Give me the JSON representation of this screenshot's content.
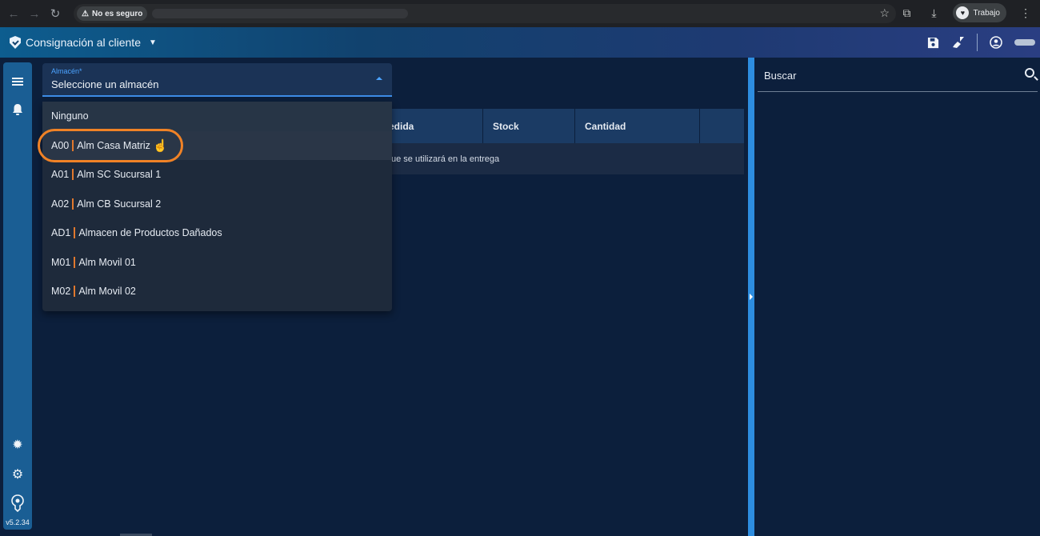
{
  "browser": {
    "security_label": "No es seguro",
    "profile_label": "Trabajo"
  },
  "app": {
    "title": "Consignación al cliente",
    "version": "v5.2.34"
  },
  "select": {
    "label": "Almacén*",
    "value": "Seleccione un almacén"
  },
  "dropdown": {
    "items": [
      {
        "code": "",
        "name": "Ninguno"
      },
      {
        "code": "A00",
        "name": "Alm Casa Matriz"
      },
      {
        "code": "A01",
        "name": "Alm SC Sucursal 1"
      },
      {
        "code": "A02",
        "name": "Alm CB Sucursal 2"
      },
      {
        "code": "AD1",
        "name": "Almacen de Productos Dañados"
      },
      {
        "code": "M01",
        "name": "Alm Movil 01"
      },
      {
        "code": "M02",
        "name": "Alm Movil 02"
      }
    ]
  },
  "table": {
    "columns": [
      "edida",
      "Stock",
      "Cantidad",
      ""
    ],
    "empty_message": "ue se utilizará en la entrega"
  },
  "right_panel": {
    "search_placeholder": "Buscar"
  },
  "colors": {
    "accent": "#3d8ce6",
    "highlight_ring": "#f08226",
    "separator": "#e0782d",
    "rail": "#1a5e94",
    "background": "#0c1f3c"
  }
}
